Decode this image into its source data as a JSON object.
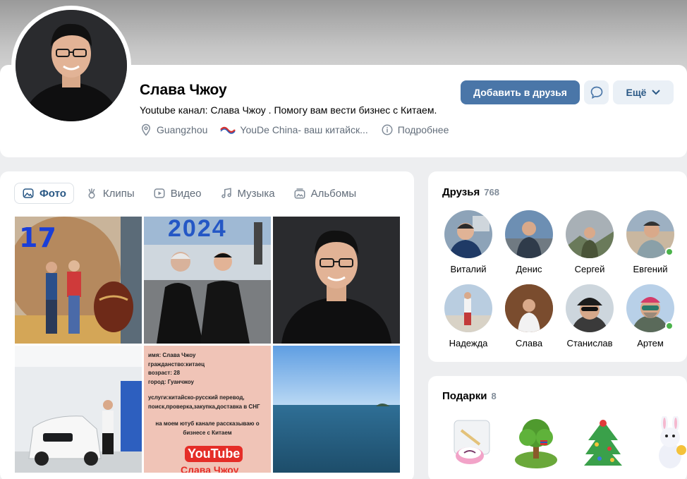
{
  "profile": {
    "name": "Слава Чжоу",
    "status": "Youtube канал: Слава Чжоу . Помогу вам вести бизнес с Китаем.",
    "location": "Guangzhou",
    "work": "YouDe China- ваш китайск...",
    "more_info": "Подробнее"
  },
  "actions": {
    "add_friend": "Добавить в друзья",
    "more": "Ещё"
  },
  "tabs": [
    {
      "label": "Фото",
      "active": true
    },
    {
      "label": "Клипы"
    },
    {
      "label": "Видео"
    },
    {
      "label": "Музыка"
    },
    {
      "label": "Альбомы"
    }
  ],
  "photos": {
    "p1_number": "17",
    "p2_year": "2024",
    "info_lines": [
      "имя: Слава Чжоу",
      "гражданство:китаец",
      "возраст: 28",
      "город: Гуанчжоу",
      "услуги:китайско-русский перевод,",
      "поиск,проверка,закупка,доставка в СНГ",
      "на моем ютуб канале рассказываю о",
      "бизнесе с Китаем"
    ],
    "youtube_logo": "YouTube",
    "youtube_channel": "Слава Чжоу"
  },
  "friends": {
    "title": "Друзья",
    "count": "768",
    "items": [
      {
        "name": "Виталий"
      },
      {
        "name": "Денис"
      },
      {
        "name": "Сергей"
      },
      {
        "name": "Евгений",
        "online": true
      },
      {
        "name": "Надежда"
      },
      {
        "name": "Слава"
      },
      {
        "name": "Станислав"
      },
      {
        "name": "Артем",
        "online": true
      }
    ]
  },
  "gifts": {
    "title": "Подарки",
    "count": "8"
  },
  "colors": {
    "accent": "#4a76a8",
    "link": "#2a5885",
    "online": "#4bb34b"
  }
}
